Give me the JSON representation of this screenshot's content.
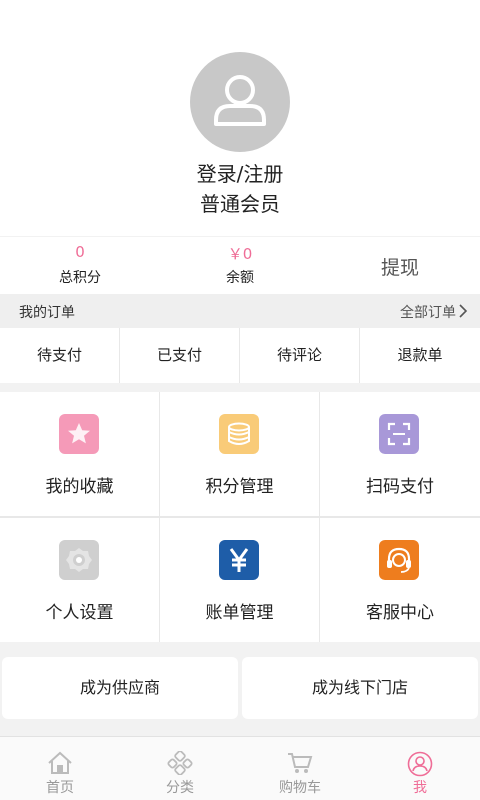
{
  "profile": {
    "login_label": "登录/注册",
    "member_level": "普通会员"
  },
  "stats": {
    "points": {
      "value": "0",
      "label": "总积分"
    },
    "balance": {
      "value": "￥0",
      "label": "余额"
    },
    "withdraw_label": "提现"
  },
  "orders": {
    "title": "我的订单",
    "all_label": "全部订单",
    "tabs": [
      "待支付",
      "已支付",
      "待评论",
      "退款单"
    ]
  },
  "grid": [
    {
      "label": "我的收藏",
      "icon": "star-icon",
      "color": "#f59ab8"
    },
    {
      "label": "积分管理",
      "icon": "coins-icon",
      "color": "#f9cb78"
    },
    {
      "label": "扫码支付",
      "icon": "scan-icon",
      "color": "#a898d8"
    },
    {
      "label": "个人设置",
      "icon": "gear-icon",
      "color": "#cfcfcf"
    },
    {
      "label": "账单管理",
      "icon": "yen-icon",
      "color": "#1e5da8"
    },
    {
      "label": "客服中心",
      "icon": "headset-icon",
      "color": "#ee7d1e"
    }
  ],
  "actions": {
    "supplier_label": "成为供应商",
    "store_label": "成为线下门店"
  },
  "tabbar": [
    {
      "label": "首页",
      "icon": "home-icon"
    },
    {
      "label": "分类",
      "icon": "category-icon"
    },
    {
      "label": "购物车",
      "icon": "cart-icon"
    },
    {
      "label": "我",
      "icon": "user-icon",
      "active": true
    }
  ],
  "colors": {
    "accent": "#ef6d97",
    "background": "#f2f2f2"
  }
}
